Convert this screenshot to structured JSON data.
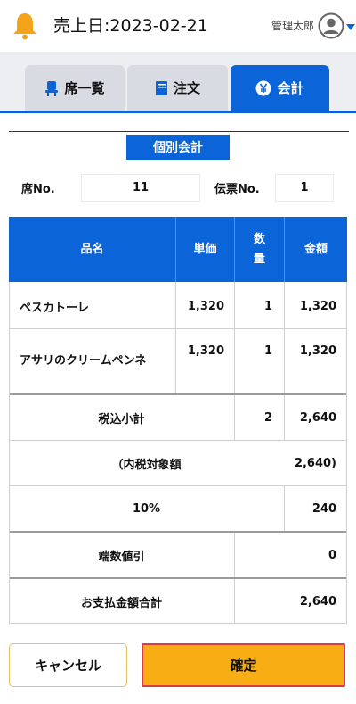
{
  "header": {
    "sales_date": "売上日:2023-02-21",
    "user_name": "管理太郎",
    "accent": "#f4a418"
  },
  "tabs": [
    {
      "label": "席一覧",
      "icon": "seat-icon",
      "active": false
    },
    {
      "label": "注文",
      "icon": "menu-book-icon",
      "active": false
    },
    {
      "label": "会計",
      "icon": "yen-icon",
      "active": true
    }
  ],
  "section_title": "個別会計",
  "seat": {
    "label": "席No.",
    "value": "11"
  },
  "slip": {
    "label": "伝票No.",
    "value": "1"
  },
  "table": {
    "headers": {
      "name": "品名",
      "price": "単価",
      "qty": "数\n量",
      "amount": "金額"
    },
    "items": [
      {
        "name": "ペスカトーレ",
        "price": "1,320",
        "qty": "1",
        "amount": "1,320"
      },
      {
        "name": "アサリのクリームペンネ",
        "price": "1,320",
        "qty": "1",
        "amount": "1,320"
      }
    ],
    "summary": {
      "subtotal_label": "税込小計",
      "subtotal_qty": "2",
      "subtotal_amount": "2,640",
      "taxable_label": "（内税対象額",
      "taxable_amount": "2,640)",
      "rate_label": "10%",
      "rate_amount": "240",
      "rounding_label": "端数値引",
      "rounding_amount": "0",
      "total_label": "お支払金額合計",
      "total_amount": "2,640"
    }
  },
  "buttons": {
    "cancel": "キャンセル",
    "confirm": "確定"
  },
  "colors": {
    "primary": "#0b64d8",
    "confirm": "#f9ad14",
    "confirm_border": "#e03a3a"
  }
}
